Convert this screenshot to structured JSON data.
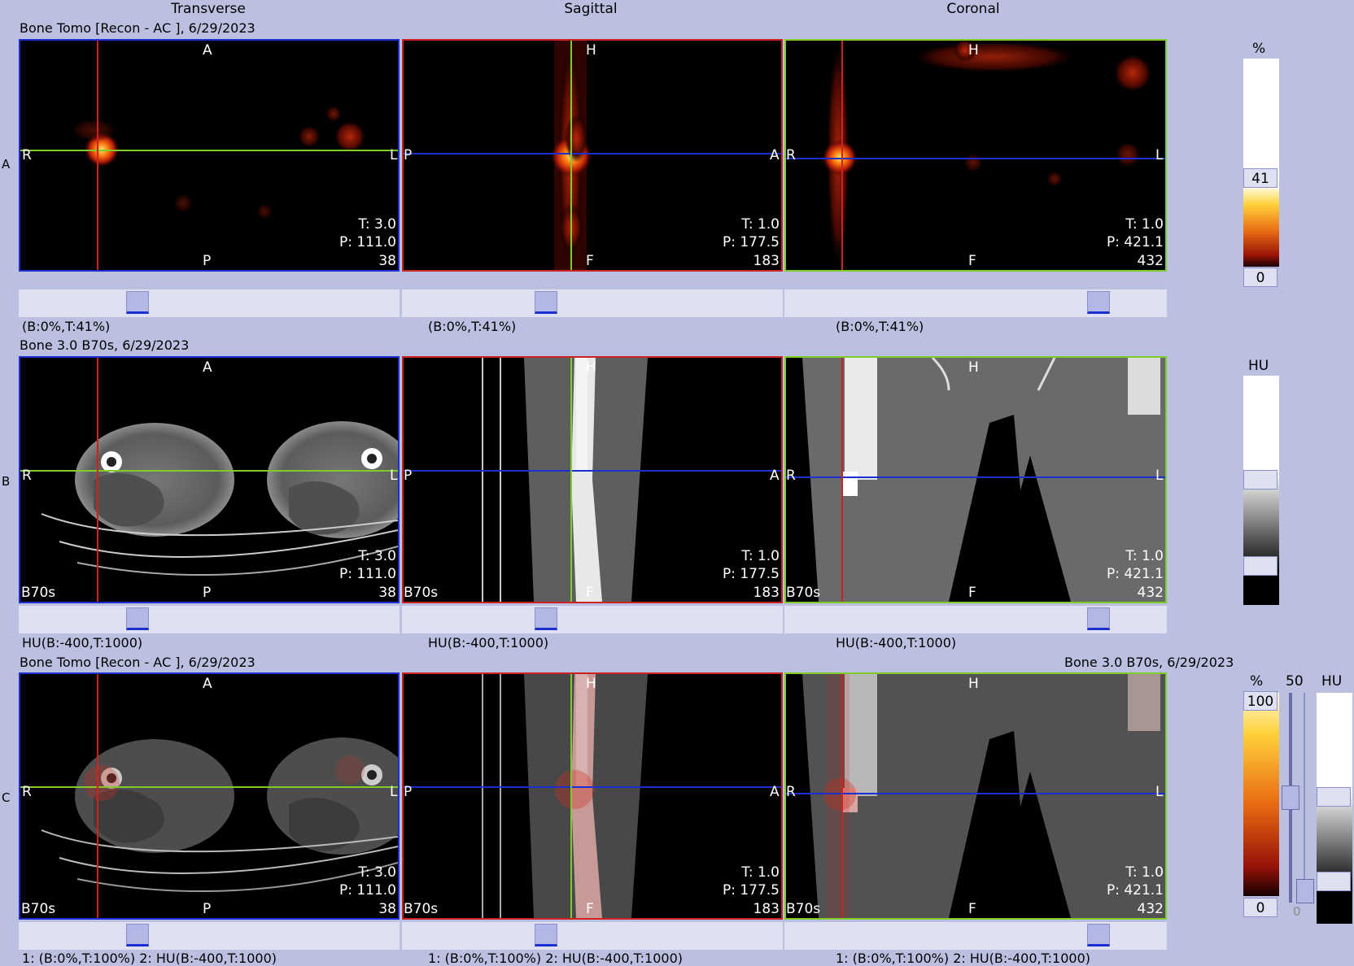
{
  "columns": {
    "transverse": "Transverse",
    "sagittal": "Sagittal",
    "coronal": "Coronal"
  },
  "rows": [
    {
      "letter": "A",
      "title": "Bone Tomo [Recon - AC ], 6/29/2023",
      "window": "(B:0%,T:41%)"
    },
    {
      "letter": "B",
      "title": "Bone  3.0  B70s, 6/29/2023",
      "window": "HU(B:-400,T:1000)"
    },
    {
      "letter": "C",
      "title": "Bone Tomo [Recon - AC ], 6/29/2023",
      "title_right": "Bone  3.0  B70s, 6/29/2023",
      "window": "1: (B:0%,T:100%)    2: HU(B:-400,T:1000)"
    }
  ],
  "orient": {
    "ant": "A",
    "post": "P",
    "right": "R",
    "left": "L",
    "head": "H",
    "foot": "F"
  },
  "kernel": "B70s",
  "views": {
    "transverse": {
      "t": "T: 3.0",
      "p": "P: 111.0",
      "slice": "38"
    },
    "sagittal": {
      "t": "T: 1.0",
      "p": "P: 177.5",
      "slice": "183"
    },
    "coronal": {
      "t": "T: 1.0",
      "p": "P: 421.1",
      "slice": "432"
    }
  },
  "luts": {
    "a": {
      "unit": "%",
      "top": "41",
      "bottom": "0"
    },
    "b": {
      "unit": "HU"
    },
    "c": {
      "unit_pct": "%",
      "blend": "50",
      "unit_hu": "HU",
      "top": "100",
      "bottom": "0",
      "blend_bottom": "0"
    }
  },
  "colors": {
    "bg": "#bcc0e0",
    "transverse_border": "#1c2fd1",
    "sagittal_border": "#cc2222",
    "coronal_border": "#7ecb2a"
  }
}
